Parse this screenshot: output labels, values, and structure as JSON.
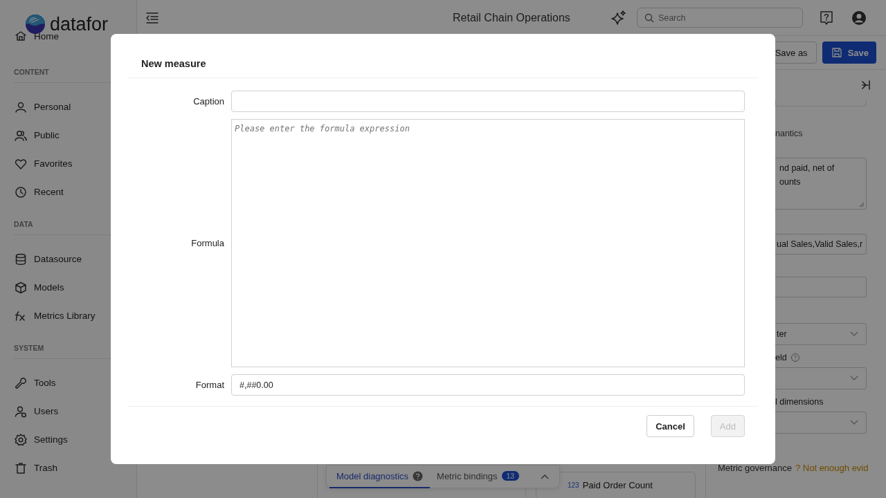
{
  "app": {
    "logo": "datafor",
    "title": "Retail Chain Operations",
    "search": {
      "placeholder": "Search"
    }
  },
  "sidebar": {
    "top_items": [
      {
        "label": "Home"
      }
    ],
    "sections": [
      {
        "title": "CONTENT",
        "items": [
          {
            "label": "Personal"
          },
          {
            "label": "Public"
          },
          {
            "label": "Favorites"
          },
          {
            "label": "Recent"
          }
        ]
      },
      {
        "title": "DATA",
        "items": [
          {
            "label": "Datasource"
          },
          {
            "label": "Models"
          },
          {
            "label": "Metrics Library"
          }
        ]
      },
      {
        "title": "SYSTEM",
        "items": [
          {
            "label": "Tools"
          },
          {
            "label": "Users"
          },
          {
            "label": "Settings"
          },
          {
            "label": "Trash"
          }
        ]
      }
    ]
  },
  "toolbar": {
    "buttons": [
      {
        "label": "Save as",
        "kind": "secondary"
      },
      {
        "label": "Save",
        "kind": "primary"
      }
    ]
  },
  "panel": {
    "rows": [
      {
        "kind": "heading",
        "text": "nantics"
      },
      {
        "kind": "textarea",
        "value": "nd paid, net of\nounts"
      },
      {
        "kind": "input",
        "value": "ual Sales,Valid Sales,r"
      },
      {
        "kind": "input"
      },
      {
        "kind": "select",
        "value": "ter"
      },
      {
        "kind": "label",
        "text": "eld",
        "help": true
      },
      {
        "kind": "select"
      },
      {
        "kind": "label",
        "text": "l dimensions"
      },
      {
        "kind": "select"
      },
      {
        "kind": "status",
        "text": "Metric governance",
        "note": "? Not enough evid"
      }
    ]
  },
  "bottom_tabs": [
    {
      "label": "Model diagnostics",
      "selected": true,
      "help": true
    },
    {
      "label": "Metric bindings",
      "selected": false,
      "badge": "13"
    }
  ],
  "field_card": {
    "type_label": "123",
    "name": "Paid Order Count"
  },
  "dialog": {
    "title": "New measure",
    "fields": [
      {
        "label": "Caption",
        "kind": "input"
      },
      {
        "label": "Formula",
        "kind": "formula",
        "placeholder": "Please enter the formula expression"
      },
      {
        "label": "Format",
        "kind": "input",
        "value": "#,##0.00"
      }
    ],
    "buttons": [
      {
        "label": "Cancel",
        "kind": "default",
        "disabled": false
      },
      {
        "label": "Add",
        "kind": "primary",
        "disabled": true
      }
    ]
  }
}
